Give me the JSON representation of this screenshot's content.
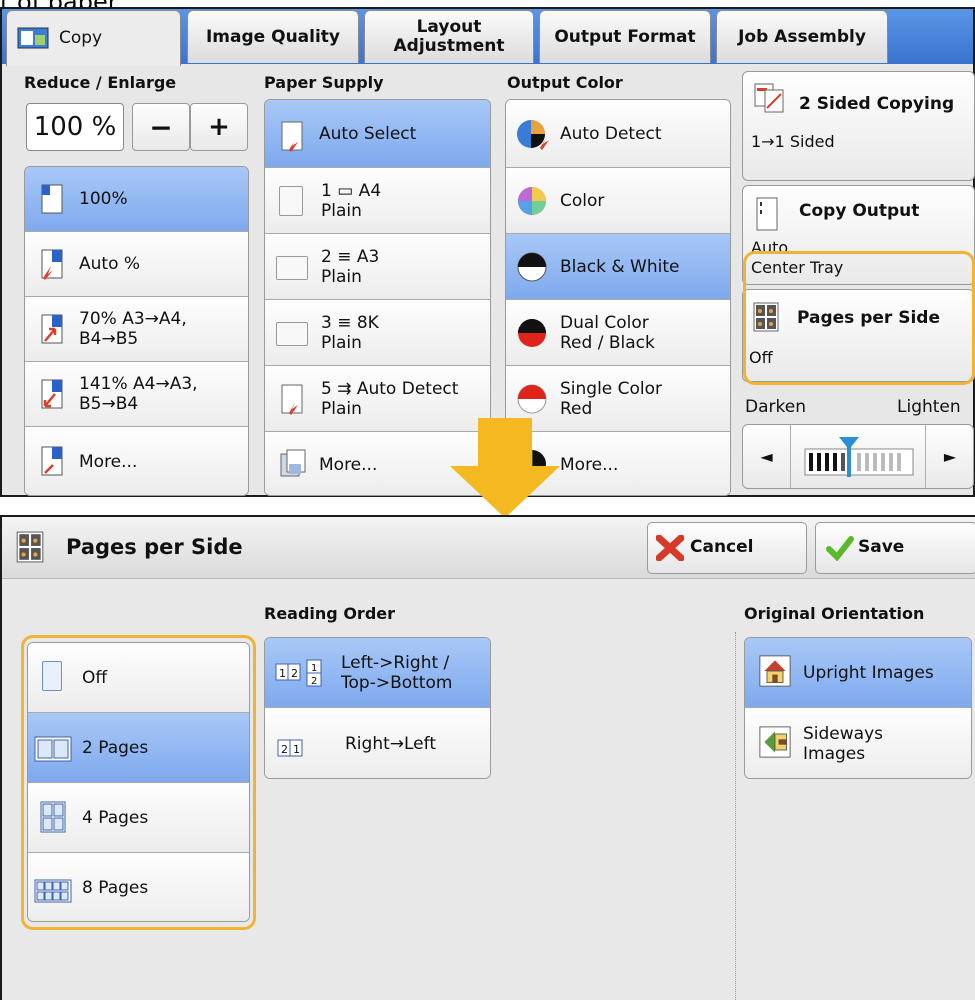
{
  "caption": "t of paper.",
  "tabs": [
    {
      "label": "Copy"
    },
    {
      "label": "Image Quality"
    },
    {
      "label": "Layout\nAdjustment"
    },
    {
      "label": "Output Format"
    },
    {
      "label": "Job Assembly"
    }
  ],
  "reduce_enlarge": {
    "label": "Reduce / Enlarge",
    "value": "100 %",
    "minus": "−",
    "plus": "+",
    "items": [
      {
        "label": "100%"
      },
      {
        "label": "Auto %"
      },
      {
        "label": "70% A3→A4,\nB4→B5"
      },
      {
        "label": "141% A4→A3,\nB5→B4"
      },
      {
        "label": "More..."
      }
    ]
  },
  "paper_supply": {
    "label": "Paper Supply",
    "auto_select": "Auto Select",
    "items": [
      {
        "line1": "1 ▭ A4",
        "line2": "Plain"
      },
      {
        "line1": "2 ≡ A3",
        "line2": "Plain"
      },
      {
        "line1": "3 ≡ 8K",
        "line2": "Plain"
      },
      {
        "line1": "5 ⇉ Auto Detect",
        "line2": "Plain"
      }
    ],
    "more": "More..."
  },
  "output_color": {
    "label": "Output Color",
    "items": [
      {
        "label": "Auto Detect"
      },
      {
        "label": "Color"
      },
      {
        "label": "Black & White"
      },
      {
        "label": "Dual Color\nRed / Black"
      },
      {
        "label": "Single Color\nRed"
      },
      {
        "label": "More..."
      }
    ]
  },
  "sided": {
    "title": "2 Sided Copying",
    "value": "1→1 Sided"
  },
  "copy_output": {
    "title": "Copy Output",
    "value1": "Auto",
    "value2": "Center Tray"
  },
  "pages_per_side_btn": {
    "title": "Pages per Side",
    "value": "Off"
  },
  "density": {
    "darken": "Darken",
    "lighten": "Lighten",
    "left": "◄",
    "right": "►",
    "level": 0.35
  },
  "dialog": {
    "title": "Pages per Side",
    "cancel": "Cancel",
    "save": "Save",
    "pages_options": [
      {
        "label": "Off"
      },
      {
        "label": "2 Pages"
      },
      {
        "label": "4 Pages"
      },
      {
        "label": "8 Pages"
      }
    ],
    "reading_order_label": "Reading Order",
    "reading_order": [
      {
        "label": "Left->Right /\nTop->Bottom"
      },
      {
        "label": "Right→Left"
      }
    ],
    "orientation_label": "Original Orientation",
    "orientation": [
      {
        "label": "Upright Images"
      },
      {
        "label": "Sideways\nImages"
      }
    ]
  },
  "colors": {
    "accent_blue": "#7fa9ee",
    "highlight": "#f2b234",
    "tab_bar": "#3a74d0"
  }
}
